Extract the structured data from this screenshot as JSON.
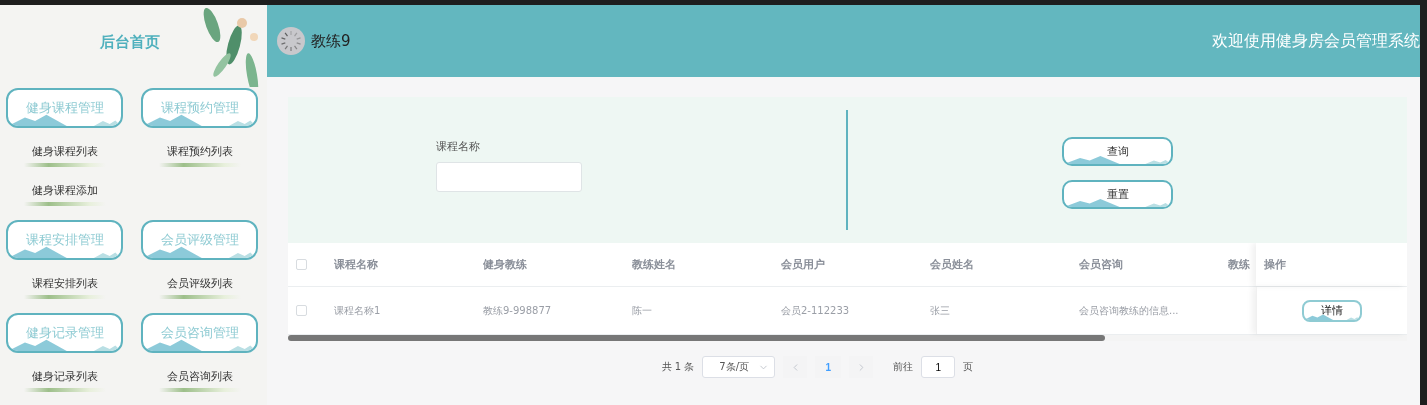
{
  "sidebar": {
    "title": "后台首页",
    "groups": [
      {
        "label": "健身课程管理",
        "children": [
          {
            "label": "健身课程列表"
          },
          {
            "label": "健身课程添加"
          }
        ]
      },
      {
        "label": "课程预约管理",
        "children": [
          {
            "label": "课程预约列表"
          }
        ]
      },
      {
        "label": "课程安排管理",
        "children": [
          {
            "label": "课程安排列表"
          }
        ]
      },
      {
        "label": "会员评级管理",
        "children": [
          {
            "label": "会员评级列表"
          }
        ]
      },
      {
        "label": "健身记录管理",
        "children": [
          {
            "label": "健身记录列表"
          }
        ]
      },
      {
        "label": "会员咨询管理",
        "children": [
          {
            "label": "会员咨询列表"
          }
        ]
      }
    ]
  },
  "header": {
    "user": "教练9",
    "welcome": "欢迎使用健身房会员管理系统"
  },
  "search": {
    "fields": [
      {
        "label": "课程名称"
      }
    ],
    "buttons": [
      "查询",
      "重置"
    ]
  },
  "table": {
    "all_checked": false,
    "columns": [
      "课程名称",
      "健身教练",
      "教练姓名",
      "会员用户",
      "会员姓名",
      "会员咨询",
      "教练"
    ],
    "action_column": "操作",
    "rows": [
      {
        "checked": false,
        "cells": [
          "课程名称1",
          "教练9-998877",
          "陈一",
          "会员2-112233",
          "张三",
          "会员咨询教练的信息..."
        ],
        "action": "详情"
      }
    ]
  },
  "pagination": {
    "total": "共 1 条",
    "page_size": "7条/页",
    "pages": [
      {
        "label": "1",
        "selected": true
      }
    ],
    "goto_label": "前往",
    "goto_value": "1",
    "goto_suffix": "页"
  }
}
